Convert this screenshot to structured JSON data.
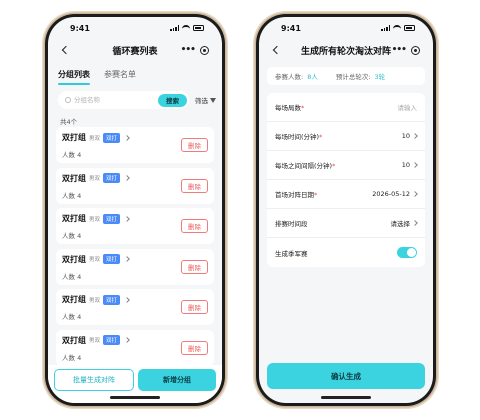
{
  "left": {
    "status_time": "9:41",
    "title": "循环赛列表",
    "tabs": [
      {
        "label": "分组列表",
        "active": true
      },
      {
        "label": "参赛名单",
        "active": false
      }
    ],
    "search": {
      "placeholder": "分组名称",
      "button_label": "搜索",
      "filter_label": "筛选"
    },
    "count_text": "共4个",
    "groups": [
      {
        "name": "双打组",
        "gender": "男双",
        "type": "双打",
        "count": "人数 4",
        "delete_label": "删除"
      },
      {
        "name": "双打组",
        "gender": "男双",
        "type": "双打",
        "count": "人数 4",
        "delete_label": "删除"
      },
      {
        "name": "双打组",
        "gender": "男双",
        "type": "双打",
        "count": "人数 4",
        "delete_label": "删除"
      },
      {
        "name": "双打组",
        "gender": "男双",
        "type": "双打",
        "count": "人数 4",
        "delete_label": "删除"
      },
      {
        "name": "双打组",
        "gender": "男双",
        "type": "双打",
        "count": "人数 4",
        "delete_label": "删除"
      },
      {
        "name": "双打组",
        "gender": "男双",
        "type": "双打",
        "count": "人数 4",
        "delete_label": "删除"
      }
    ],
    "bottom": {
      "batch_label": "批量生成对阵",
      "add_label": "新增分组"
    }
  },
  "right": {
    "status_time": "9:41",
    "title": "生成所有轮次淘汰对阵",
    "info": {
      "participants_label": "参赛人数:",
      "participants_value": "8人",
      "rounds_label": "预计总轮次:",
      "rounds_value": "3轮"
    },
    "form": {
      "rounds_label": "每场局数",
      "rounds_placeholder": "请输入",
      "duration_label": "每场时间(分钟)",
      "duration_value": "10",
      "interval_label": "每场之间间隔(分钟)",
      "interval_value": "10",
      "date_label": "首场对阵日期",
      "date_value": "2026-05-12",
      "slot_label": "排赛时间段",
      "slot_value": "请选择",
      "third_label": "生成季军赛",
      "third_enabled": true
    },
    "confirm_label": "确认生成"
  },
  "colors": {
    "accent": "#3cd3e0",
    "danger": "#e85a5a",
    "badge": "#4a8bf7"
  }
}
